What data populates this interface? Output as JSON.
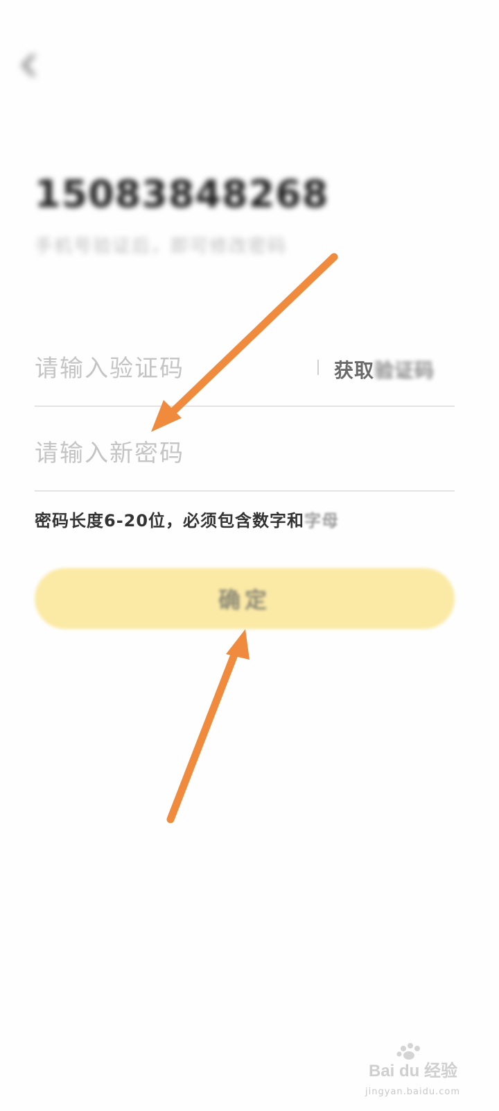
{
  "status_bar": {
    "left_text": "",
    "right_text": ""
  },
  "nav": {
    "title": ""
  },
  "account": {
    "phone": "15083848268",
    "hint": "手机号验证后，即可修改密码"
  },
  "form": {
    "code_placeholder": "请输入验证码",
    "get_code_visible": "获取",
    "get_code_faded": "验证码",
    "password_placeholder": "请输入新密码",
    "rule_main": "密码长度6-20位，必须包含数字和",
    "rule_faded": "字母",
    "confirm_label": "确定"
  },
  "watermark": {
    "text": "Bai du 经验",
    "sub": "jingyan.baidu.com"
  },
  "colors": {
    "button_bg": "#fbeaa6",
    "arrow": "#f08a3c"
  }
}
